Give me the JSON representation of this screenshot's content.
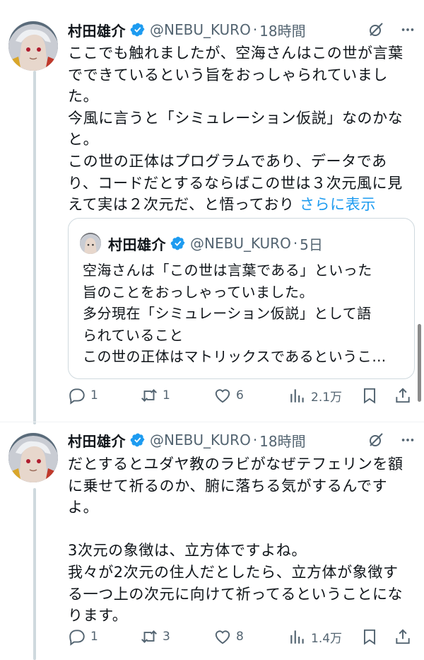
{
  "tweets": [
    {
      "name": "村田雄介",
      "handle": "@NEBU_KURO",
      "dot": "·",
      "time": "18時間",
      "body": "ここでも触れましたが、空海さんはこの世が言葉\nでできているという旨をおっしゃられていまし\nた。\n今風に言うと「シミュレーション仮説」なのかな\nと。\nこの世の正体はプログラムであり、データであ\nり、コードだとするならばこの世は３次元風に見\nえて実は２次元だ、と悟っており",
      "show_more": "さらに表示",
      "quote": {
        "name": "村田雄介",
        "handle": "@NEBU_KURO",
        "dot": "·",
        "time": "5日",
        "body": "空海さんは「この世は言葉である」といった\n旨のことをおっしゃっていました。\n多分現在「シミュレーション仮説」として語\nられていること\nこの世の正体はマトリックスであるというこ…"
      },
      "replies": "1",
      "retweets": "1",
      "likes": "6",
      "views": "2.1万"
    },
    {
      "name": "村田雄介",
      "handle": "@NEBU_KURO",
      "dot": "·",
      "time": "18時間",
      "body": "だとするとユダヤ教のラビがなぜテフェリンを額\nに乗せて祈るのか、腑に落ちる気がするんです\nよ。\n\n3次元の象徴は、立方体ですよね。\n我々が2次元の住人だとしたら、立方体が象徴す\nる一つ上の次元に向けて祈ってるということにな\nります。",
      "replies": "1",
      "retweets": "3",
      "likes": "8",
      "views": "1.4万"
    }
  ],
  "colors": {
    "text": "#0f1419",
    "muted": "#536471",
    "link": "#1d9bf0",
    "verified": "#1d9bf0",
    "border": "#cfd9de"
  },
  "icons": [
    "verified-badge-icon",
    "grok-icon",
    "more-icon",
    "reply-icon",
    "retweet-icon",
    "like-icon",
    "views-icon",
    "bookmark-icon",
    "share-icon"
  ]
}
